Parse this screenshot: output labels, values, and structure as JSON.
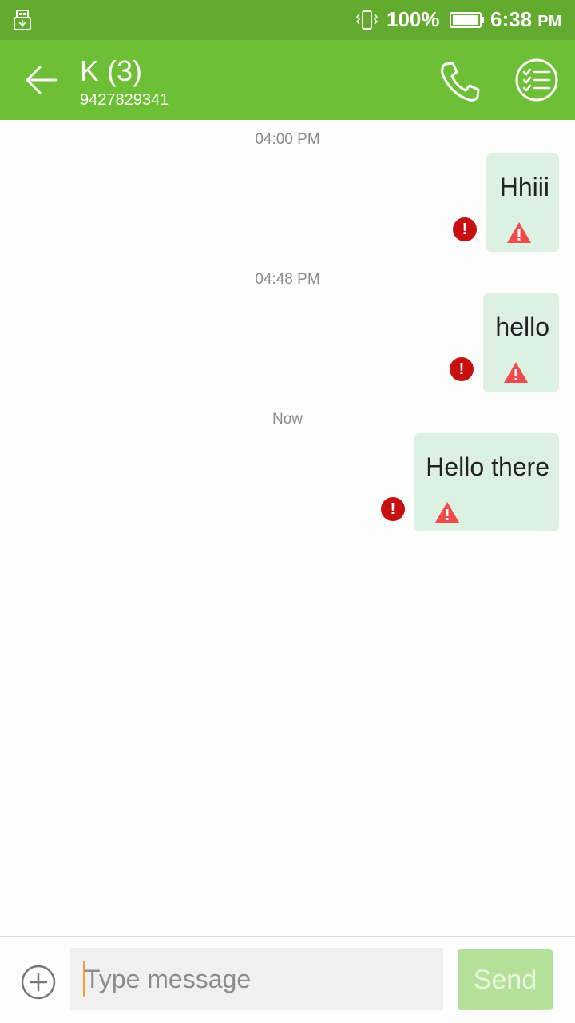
{
  "status_bar": {
    "battery_percent": "100%",
    "time": "6:38",
    "time_suffix": "PM",
    "icons": [
      "usb-icon",
      "vibrate-icon",
      "battery-icon"
    ]
  },
  "header": {
    "title": "K (3)",
    "subtitle": "9427829341",
    "icons": [
      "back-arrow-icon",
      "phone-call-icon",
      "checklist-icon"
    ]
  },
  "messages": [
    {
      "timestamp": "04:00 PM",
      "text": "Hhiii",
      "status": "failed"
    },
    {
      "timestamp": "04:48 PM",
      "text": "hello",
      "status": "failed"
    },
    {
      "timestamp": "Now",
      "text": "Hello there",
      "status": "failed"
    }
  ],
  "composer": {
    "placeholder": "Type message",
    "send_label": "Send",
    "attach_icon": "add-circle-icon"
  },
  "colors": {
    "status_bar": "#62ab2e",
    "app_bar": "#6dbf35",
    "bubble": "#dcf1e1",
    "error": "#c81010",
    "warning": "#f24a4a",
    "send_disabled": "#b5e09a"
  }
}
